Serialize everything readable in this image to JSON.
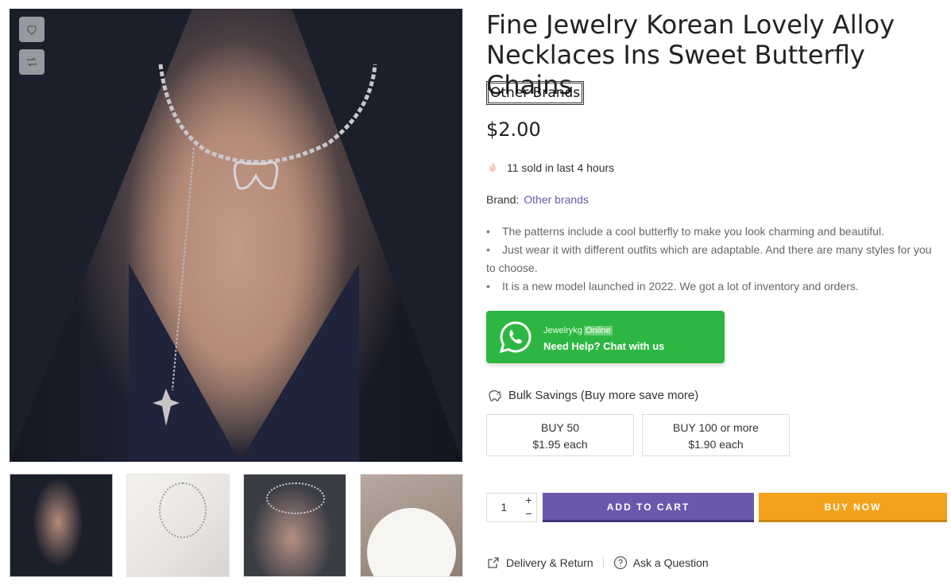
{
  "product": {
    "title": "Fine Jewelry Korean Lovely Alloy Necklaces Ins Sweet Butterfly Chains",
    "brand_badge": "Other Brands",
    "price": "$2.00",
    "sold_text": "11 sold in last 4 hours",
    "brand_label": "Brand:",
    "brand_link": "Other brands",
    "bullets": [
      "The patterns include a cool butterfly to make you look charming and beautiful.",
      "Just wear it with different outfits which are adaptable. And there are many styles for you to choose.",
      "It is a new model launched in 2022. We got a lot of inventory and orders."
    ]
  },
  "whatsapp": {
    "name": "Jewelrykg",
    "status": "Online",
    "cta": "Need Help? Chat with us",
    "color": "#2db742"
  },
  "bulk": {
    "title": "Bulk Savings (Buy more save more)",
    "tiers": [
      {
        "qty": "BUY 50",
        "price": "$1.95 each"
      },
      {
        "qty": "BUY 100 or more",
        "price": "$1.90 each"
      }
    ]
  },
  "cart": {
    "quantity": "1",
    "plus": "+",
    "minus": "−",
    "add_to_cart": "ADD TO CART",
    "buy_now": "BUY NOW",
    "add_color": "#6b58ad",
    "buy_color": "#f2a31b"
  },
  "links": {
    "delivery": "Delivery & Return",
    "ask": "Ask a Question"
  },
  "icons": {
    "wishlist": "heart-icon",
    "compare": "compare-arrows-icon",
    "sold": "flame-icon",
    "whatsapp": "whatsapp-icon",
    "bulk": "piggy-bank-icon",
    "delivery": "share-box-icon",
    "ask": "question-circle-icon"
  }
}
